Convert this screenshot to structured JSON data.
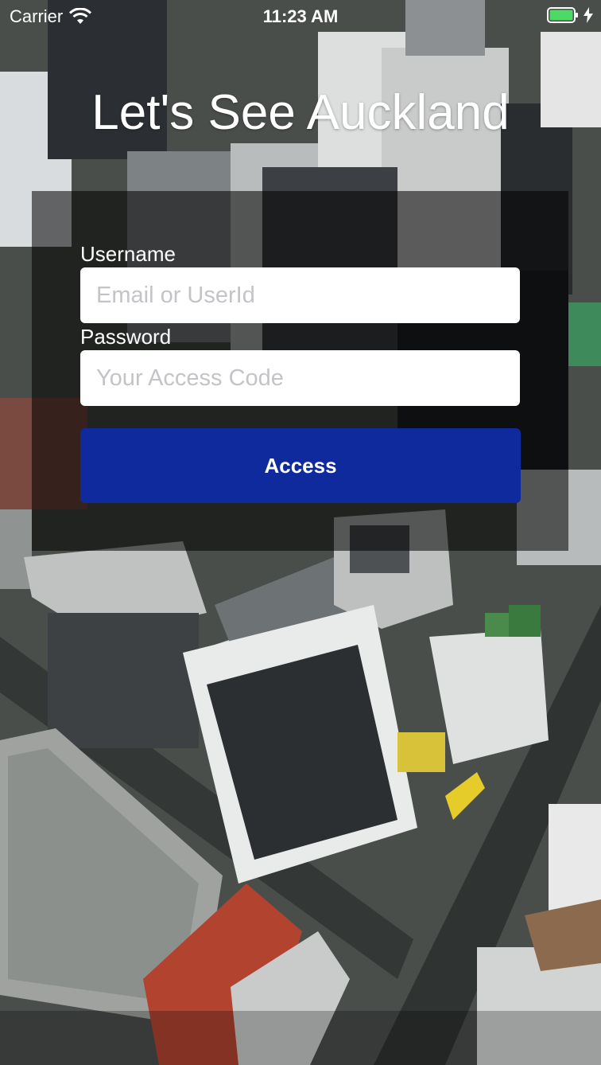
{
  "status_bar": {
    "carrier": "Carrier",
    "time": "11:23 AM",
    "battery_color": "#4cd964"
  },
  "title": "Let's See Auckland",
  "form": {
    "username_label": "Username",
    "username_placeholder": "Email or UserId",
    "username_value": "",
    "password_label": "Password",
    "password_placeholder": "Your Access Code",
    "password_value": "",
    "access_label": "Access",
    "access_button_color": "#0f2a9c"
  },
  "icons": [
    "wifi-icon",
    "battery-icon",
    "charging-bolt-icon"
  ]
}
